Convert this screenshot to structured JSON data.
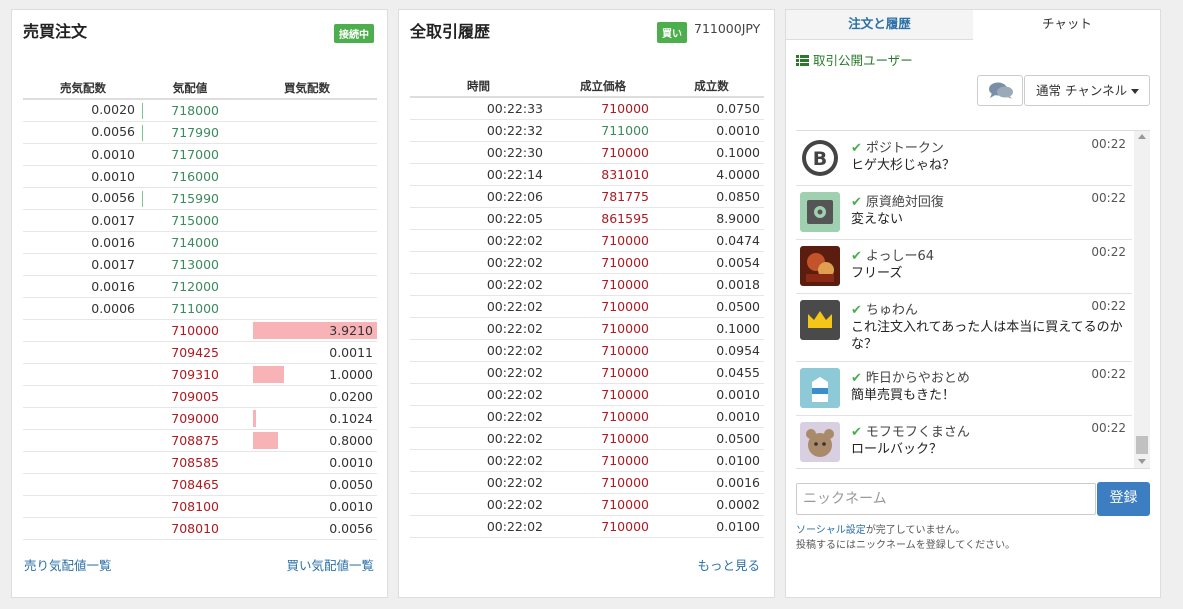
{
  "orderbook": {
    "title": "売買注文",
    "status": "接続中",
    "headers": [
      "売気配数",
      "気配値",
      "買気配数"
    ],
    "asks": [
      {
        "size": "0.0020",
        "price": "718000",
        "depth": 1
      },
      {
        "size": "0.0056",
        "price": "717990",
        "depth": 1
      },
      {
        "size": "0.0010",
        "price": "717000",
        "depth": 0
      },
      {
        "size": "0.0010",
        "price": "716000",
        "depth": 0
      },
      {
        "size": "0.0056",
        "price": "715990",
        "depth": 1
      },
      {
        "size": "0.0017",
        "price": "715000",
        "depth": 0
      },
      {
        "size": "0.0016",
        "price": "714000",
        "depth": 0
      },
      {
        "size": "0.0017",
        "price": "713000",
        "depth": 0
      },
      {
        "size": "0.0016",
        "price": "712000",
        "depth": 0
      },
      {
        "size": "0.0006",
        "price": "711000",
        "depth": 0
      }
    ],
    "bids": [
      {
        "price": "710000",
        "size": "3.9210",
        "depth": 1.0
      },
      {
        "price": "709425",
        "size": "0.0011",
        "depth": 0
      },
      {
        "price": "709310",
        "size": "1.0000",
        "depth": 0.25
      },
      {
        "price": "709005",
        "size": "0.0200",
        "depth": 0
      },
      {
        "price": "709000",
        "size": "0.1024",
        "depth": 0.026
      },
      {
        "price": "708875",
        "size": "0.8000",
        "depth": 0.2
      },
      {
        "price": "708585",
        "size": "0.0010",
        "depth": 0
      },
      {
        "price": "708465",
        "size": "0.0050",
        "depth": 0
      },
      {
        "price": "708100",
        "size": "0.0010",
        "depth": 0
      },
      {
        "price": "708010",
        "size": "0.0056",
        "depth": 0
      }
    ],
    "sell_link": "売り気配値一覧",
    "buy_link": "買い気配値一覧"
  },
  "trades": {
    "title": "全取引履歴",
    "side_badge": "買い",
    "last_price": "711000JPY",
    "headers": [
      "時間",
      "成立価格",
      "成立数"
    ],
    "rows": [
      {
        "time": "00:22:33",
        "price": "710000",
        "amount": "0.0750",
        "side": "red"
      },
      {
        "time": "00:22:32",
        "price": "711000",
        "amount": "0.0010",
        "side": "green"
      },
      {
        "time": "00:22:30",
        "price": "710000",
        "amount": "0.1000",
        "side": "red"
      },
      {
        "time": "00:22:14",
        "price": "831010",
        "amount": "4.0000",
        "side": "red"
      },
      {
        "time": "00:22:06",
        "price": "781775",
        "amount": "0.0850",
        "side": "red"
      },
      {
        "time": "00:22:05",
        "price": "861595",
        "amount": "8.9000",
        "side": "red"
      },
      {
        "time": "00:22:02",
        "price": "710000",
        "amount": "0.0474",
        "side": "red"
      },
      {
        "time": "00:22:02",
        "price": "710000",
        "amount": "0.0054",
        "side": "red"
      },
      {
        "time": "00:22:02",
        "price": "710000",
        "amount": "0.0018",
        "side": "red"
      },
      {
        "time": "00:22:02",
        "price": "710000",
        "amount": "0.0500",
        "side": "red"
      },
      {
        "time": "00:22:02",
        "price": "710000",
        "amount": "0.1000",
        "side": "red"
      },
      {
        "time": "00:22:02",
        "price": "710000",
        "amount": "0.0954",
        "side": "red"
      },
      {
        "time": "00:22:02",
        "price": "710000",
        "amount": "0.0455",
        "side": "red"
      },
      {
        "time": "00:22:02",
        "price": "710000",
        "amount": "0.0010",
        "side": "red"
      },
      {
        "time": "00:22:02",
        "price": "710000",
        "amount": "0.0010",
        "side": "red"
      },
      {
        "time": "00:22:02",
        "price": "710000",
        "amount": "0.0500",
        "side": "red"
      },
      {
        "time": "00:22:02",
        "price": "710000",
        "amount": "0.0100",
        "side": "red"
      },
      {
        "time": "00:22:02",
        "price": "710000",
        "amount": "0.0016",
        "side": "red"
      },
      {
        "time": "00:22:02",
        "price": "710000",
        "amount": "0.0002",
        "side": "red"
      },
      {
        "time": "00:22:02",
        "price": "710000",
        "amount": "0.0100",
        "side": "red"
      }
    ],
    "more_link": "もっと見る"
  },
  "chat": {
    "tab_orders": "注文と履歴",
    "tab_chat": "チャット",
    "public_users_link": "取引公開ユーザー",
    "channel": "通常 チャンネル",
    "messages": [
      {
        "user": "ポジトークン",
        "time": "00:22",
        "text": "ヒゲ大杉じゃね？",
        "avatar": "bitcoin-avatar"
      },
      {
        "user": "原資絶対回復",
        "time": "00:22",
        "text": "変えない",
        "avatar": "safe-avatar"
      },
      {
        "user": "よっしー64",
        "time": "00:22",
        "text": "フリーズ",
        "avatar": "photo-avatar"
      },
      {
        "user": "ちゅわん",
        "time": "00:22",
        "text": "これ注文入れてあった人は本当に買えてるのかな？",
        "avatar": "crown-avatar"
      },
      {
        "user": "昨日からやおとめ",
        "time": "00:22",
        "text": "簡単売買もきた！",
        "avatar": "milk-avatar"
      },
      {
        "user": "モフモフくまさん",
        "time": "00:22",
        "text": "ロールバック？",
        "avatar": "bear-avatar"
      }
    ],
    "nickname_placeholder": "ニックネーム",
    "register_label": "登録",
    "note_line1_link": "ソーシャル設定",
    "note_line1_rest": "が完了していません。",
    "note_line2": "投稿するにはニックネームを登録してください。"
  },
  "colors": {
    "ask": "#3c8a5e",
    "bid": "#b0191f",
    "bid_bar": "#f7b3b6",
    "badge": "#4cae4c",
    "link": "#2a6fa8",
    "button": "#3d7dc2"
  }
}
